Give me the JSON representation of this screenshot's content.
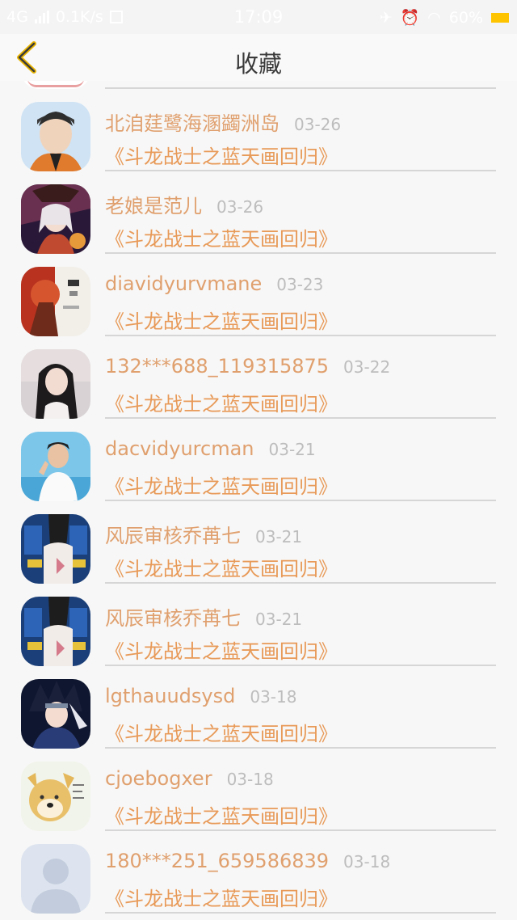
{
  "status_bar": {
    "network": "4G",
    "speed": "0.1K/s",
    "time": "17:09",
    "battery": "60%",
    "battery_color": "#ffc400"
  },
  "header": {
    "title": "收藏",
    "back_icon": "chevron-left-icon",
    "back_color": "#e8b400"
  },
  "colors": {
    "name": "#e0a06e",
    "subtitle": "#e89a58",
    "date": "#bdbdbd",
    "separator": "#d6d6d6"
  },
  "favorites": [
    {
      "name": "北洎莛鹭海溷蠲洲岛",
      "date": "03-26",
      "title": "《斗龙战士之蓝天画回归》"
    },
    {
      "name": "老娘是范儿",
      "date": "03-26",
      "title": "《斗龙战士之蓝天画回归》"
    },
    {
      "name": "diavidyurvmane",
      "date": "03-23",
      "title": "《斗龙战士之蓝天画回归》"
    },
    {
      "name": "132***688_119315875",
      "date": "03-22",
      "title": "《斗龙战士之蓝天画回归》"
    },
    {
      "name": "dacvidyurcman",
      "date": "03-21",
      "title": "《斗龙战士之蓝天画回归》"
    },
    {
      "name": "风辰审核乔苒七",
      "date": "03-21",
      "title": "《斗龙战士之蓝天画回归》"
    },
    {
      "name": "风辰审核乔苒七",
      "date": "03-21",
      "title": "《斗龙战士之蓝天画回归》"
    },
    {
      "name": "lgthauudsysd",
      "date": "03-18",
      "title": "《斗龙战士之蓝天画回归》"
    },
    {
      "name": "cjoebogxer",
      "date": "03-18",
      "title": "《斗龙战士之蓝天画回归》"
    },
    {
      "name": "180***251_659586839",
      "date": "03-18",
      "title": "《斗龙战士之蓝天画回归》"
    }
  ]
}
